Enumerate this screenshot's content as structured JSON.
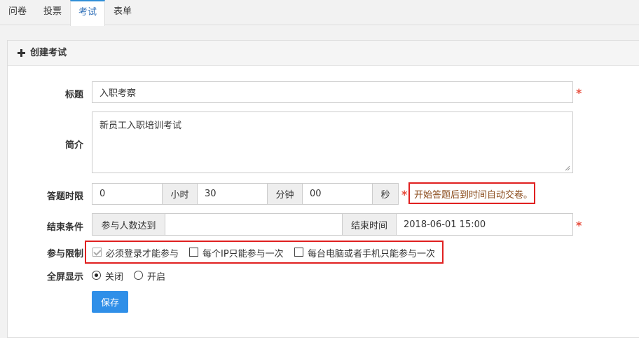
{
  "tabs": [
    {
      "label": "问卷",
      "active": false
    },
    {
      "label": "投票",
      "active": false
    },
    {
      "label": "考试",
      "active": true
    },
    {
      "label": "表单",
      "active": false
    }
  ],
  "panel": {
    "title": "创建考试"
  },
  "form": {
    "title_label": "标题",
    "title_value": "入职考察",
    "intro_label": "简介",
    "intro_value": "新员工入职培训考试",
    "duration_label": "答题时限",
    "hours_value": "0",
    "hours_unit": "小时",
    "minutes_value": "30",
    "minutes_unit": "分钟",
    "seconds_value": "00",
    "seconds_unit": "秒",
    "duration_hint": "开始答题后到时间自动交卷。",
    "end_label": "结束条件",
    "participants_addon": "参与人数达到",
    "participants_value": "",
    "end_time_addon": "结束时间",
    "end_time_value": "2018-06-01 15:00",
    "limit_label": "参与限制",
    "limit_options": [
      {
        "label": "必须登录才能参与",
        "checked": true,
        "disabled": true
      },
      {
        "label": "每个IP只能参与一次",
        "checked": false,
        "disabled": false
      },
      {
        "label": "每台电脑或者手机只能参与一次",
        "checked": false,
        "disabled": false
      }
    ],
    "fullscreen_label": "全屏显示",
    "fullscreen_options": [
      {
        "label": "关闭",
        "selected": true
      },
      {
        "label": "开启",
        "selected": false
      }
    ],
    "required_mark": "*",
    "save_label": "保存"
  },
  "colors": {
    "accent": "#2f8fe8",
    "required": "#e74c3c",
    "highlight_box": "#e02020"
  }
}
